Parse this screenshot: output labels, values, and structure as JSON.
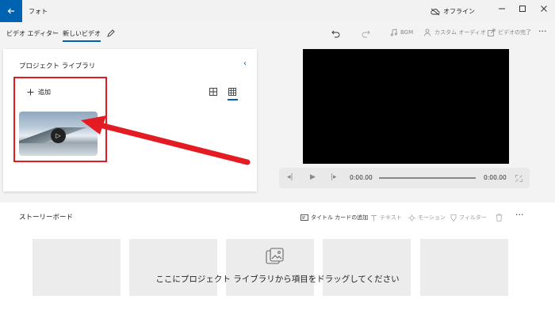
{
  "window": {
    "app_title": "フォト",
    "offline_label": "オフライン"
  },
  "toolbar": {
    "breadcrumb_root": "ビデオ エディター",
    "breadcrumb_current": "新しいビデオ",
    "bgm_label": "BGM",
    "custom_audio_label": "カスタム オーディオ",
    "finish_video_label": "ビデオの完了"
  },
  "library": {
    "title": "プロジェクト ライブラリ",
    "add_label": "追加"
  },
  "player": {
    "current_time": "0:00.00",
    "total_time": "0:00.00",
    "progress_fraction": 0
  },
  "storyboard": {
    "title": "ストーリーボード",
    "title_card_label": "タイトル カードの追加",
    "text_label": "テキスト",
    "motion_label": "モーション",
    "filter_label": "フィルター",
    "drop_hint": "ここにプロジェクト ライブラリから項目をドラッグしてください"
  },
  "annotation": {
    "highlight_color": "#e31b23"
  },
  "colors": {
    "accent": "#0063b1"
  }
}
